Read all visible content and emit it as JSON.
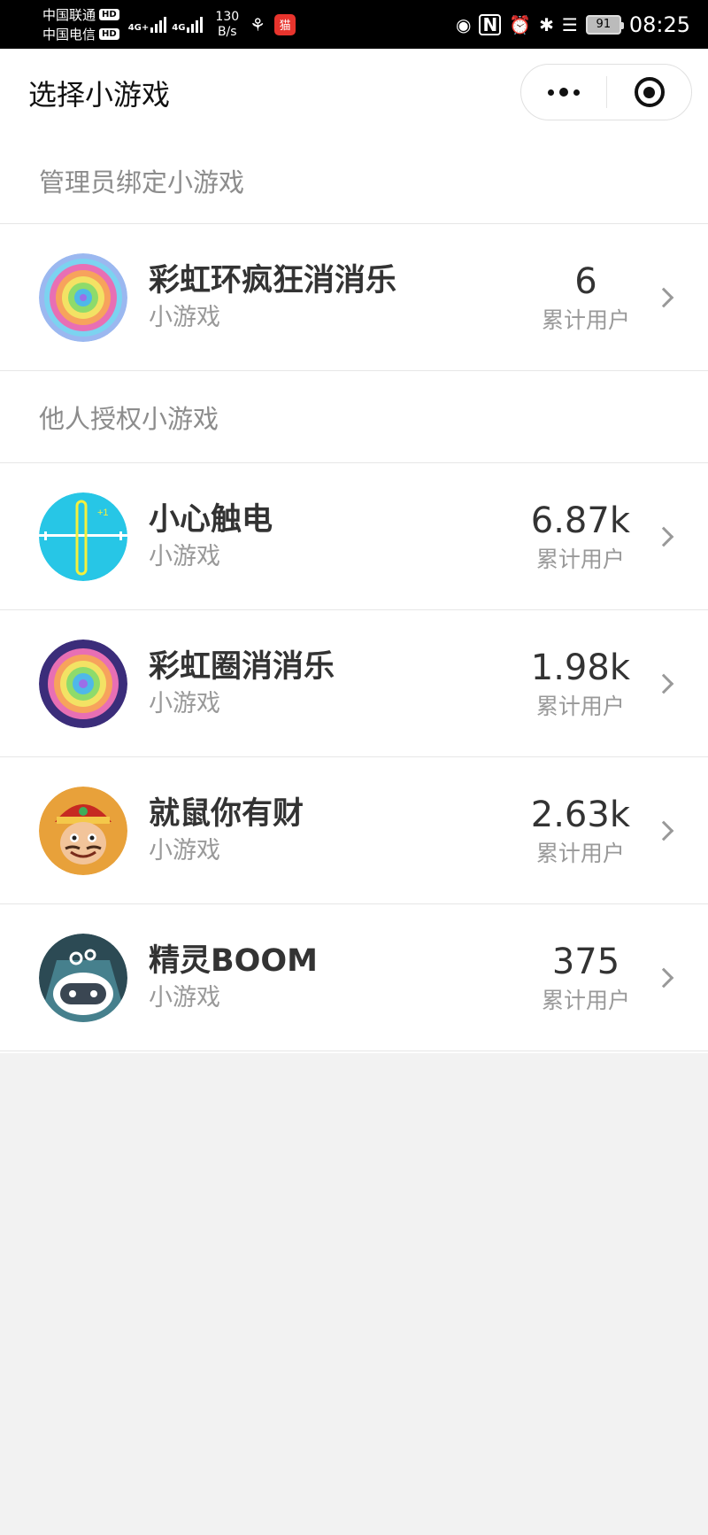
{
  "status_bar": {
    "carrier_1": "中国联通",
    "carrier_2": "中国电信",
    "hd": "HD",
    "net_1": "4G+",
    "net_2": "4G",
    "speed_value": "130",
    "speed_unit": "B/s",
    "app_badge": "猫",
    "battery": "91",
    "time": "08:25"
  },
  "nav": {
    "title": "选择小游戏"
  },
  "sections": [
    {
      "title": "管理员绑定小游戏",
      "games": [
        {
          "name": "彩虹环疯狂消消乐",
          "type": "小游戏",
          "users": "6",
          "users_label": "累计用户",
          "icon": "rainbow-ring-icon"
        }
      ]
    },
    {
      "title": "他人授权小游戏",
      "games": [
        {
          "name": "小心触电",
          "type": "小游戏",
          "users": "6.87k",
          "users_label": "累计用户",
          "icon": "electric-wire-icon"
        },
        {
          "name": "彩虹圈消消乐",
          "type": "小游戏",
          "users": "1.98k",
          "users_label": "累计用户",
          "icon": "rainbow-circle-icon"
        },
        {
          "name": "就鼠你有财",
          "type": "小游戏",
          "users": "2.63k",
          "users_label": "累计用户",
          "icon": "fortune-god-icon"
        },
        {
          "name": "精灵BOOM",
          "type": "小游戏",
          "users": "375",
          "users_label": "累计用户",
          "icon": "robot-sprite-icon"
        }
      ]
    }
  ],
  "colors": {
    "page_bg": "#f2f2f2",
    "card_bg": "#ffffff",
    "primary_text": "#333333",
    "secondary_text": "#999999"
  }
}
